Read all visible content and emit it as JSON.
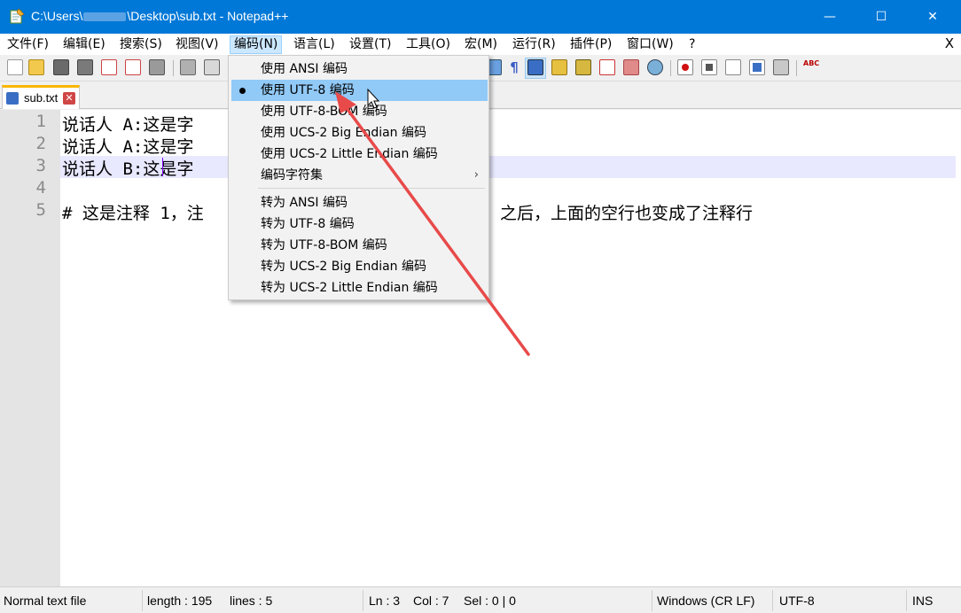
{
  "window": {
    "title_prefix": "C:\\Users\\",
    "title_suffix": "\\Desktop\\sub.txt - Notepad++",
    "min_glyph": "—",
    "max_glyph": "☐",
    "close_glyph": "✕"
  },
  "menubar": {
    "items": [
      "文件(F)",
      "编辑(E)",
      "搜索(S)",
      "视图(V)",
      "编码(N)",
      "语言(L)",
      "设置(T)",
      "工具(O)",
      "宏(M)",
      "运行(R)",
      "插件(P)",
      "窗口(W)",
      "?"
    ],
    "close_doc": "X",
    "active_index": 4
  },
  "tab": {
    "label": "sub.txt",
    "close_glyph": "✕"
  },
  "editor": {
    "line_numbers": [
      "1",
      "2",
      "3",
      "4",
      "5"
    ],
    "lines": [
      "说话人 A:这是字",
      "说话人 A:这是字",
      "说话人 B:这是字",
      "",
      "# 这是注释 1，注"
    ],
    "line5_tail": "之后，上面的空行也变成了注释行",
    "current_line": 3
  },
  "encoding_menu": {
    "items": [
      {
        "label": "使用 ANSI 编码",
        "selected": false
      },
      {
        "label": "使用 UTF-8 编码",
        "selected": true,
        "highlighted": true
      },
      {
        "label": "使用 UTF-8-BOM 编码",
        "selected": false
      },
      {
        "label": "使用 UCS-2 Big Endian 编码",
        "selected": false
      },
      {
        "label": "使用 UCS-2 Little Endian 编码",
        "selected": false
      },
      {
        "label": "编码字符集",
        "submenu": true,
        "arrow": "›"
      },
      {
        "label": "转为 ANSI 编码"
      },
      {
        "label": "转为 UTF-8 编码"
      },
      {
        "label": "转为 UTF-8-BOM 编码"
      },
      {
        "label": "转为 UCS-2 Big Endian 编码"
      },
      {
        "label": "转为 UCS-2 Little Endian 编码"
      }
    ]
  },
  "statusbar": {
    "file_type": "Normal text file",
    "length": "length : 195",
    "lines": "lines : 5",
    "ln": "Ln : 3",
    "col": "Col : 7",
    "sel": "Sel : 0 | 0",
    "eol": "Windows (CR LF)",
    "encoding": "UTF-8",
    "mode": "INS"
  },
  "colors": {
    "titlebar": "#0078d7",
    "menu_highlight": "#91c9f7",
    "annotation_arrow": "#e84a4a",
    "tab_accent": "#fab600"
  }
}
